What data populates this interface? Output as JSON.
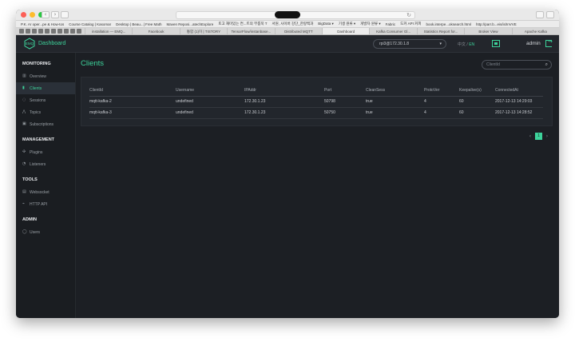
{
  "browser": {
    "bookmarks": [
      "P.K. Ar oper...pe & How-tos",
      "Course Catalog | Kasomar",
      "Desktop | Beau...| Free Math",
      "Maven Reposi...atechExplore",
      "토고 재미있는 컨...트의 부룹북 T",
      "서원, 사이버 강단_한랑백과",
      "BigData ▾",
      "기생 원류 ▾",
      "개발자 원류 ▾",
      "Fabric",
      "도커 API 커피",
      "book.interpe...oksearch.html",
      "http://parr.b...eis/is/InVVE"
    ],
    "tabs": [
      "installation — EMQ...",
      "Facebook",
      "통합 (1)이 | TISTORY",
      "TensorFlow/instanbase...",
      "Distributed MQTT",
      "Dashboard",
      "Kafka Consumer Gl...",
      "Statistics Report for...",
      "Broker View",
      "Apache Kafka"
    ],
    "active_tab_index": 5
  },
  "header": {
    "logo_text": "EMQ",
    "brand": "Dashboard",
    "node": "rpi3@172.30.1.8",
    "lang_ko": "中文",
    "lang_sep": " / ",
    "lang_en": "EN",
    "user": "admin"
  },
  "sidebar": {
    "sections": [
      {
        "title": "MONITORING",
        "items": [
          {
            "label": "Overview",
            "icon": "chart-icon"
          },
          {
            "label": "Clients",
            "icon": "document-icon",
            "active": true
          },
          {
            "label": "Sessions",
            "icon": "sessions-icon"
          },
          {
            "label": "Topics",
            "icon": "topics-icon"
          },
          {
            "label": "Subscriptions",
            "icon": "subscriptions-icon"
          }
        ]
      },
      {
        "title": "MANAGEMENT",
        "items": [
          {
            "label": "Plugins",
            "icon": "plugin-icon"
          },
          {
            "label": "Listeners",
            "icon": "listener-icon"
          }
        ]
      },
      {
        "title": "TOOLS",
        "items": [
          {
            "label": "Websocket",
            "icon": "websocket-icon"
          },
          {
            "label": "HTTP API",
            "icon": "api-icon"
          }
        ]
      },
      {
        "title": "ADMIN",
        "items": [
          {
            "label": "Users",
            "icon": "users-icon"
          }
        ]
      }
    ]
  },
  "main": {
    "title": "Clients",
    "search_placeholder": "ClientId",
    "columns": [
      "ClientId",
      "Username",
      "IPAddr",
      "Port",
      "CleanSess",
      "ProtoVer",
      "Keepalive(s)",
      "ConnectedAt"
    ],
    "rows": [
      [
        "mqtt-kafka-2",
        "undefined",
        "172.30.1.23",
        "50798",
        "true",
        "4",
        "60",
        "2017-12-13 14:29:03"
      ],
      [
        "mqtt-kafka-3",
        "undefined",
        "172.30.1.23",
        "50750",
        "true",
        "4",
        "60",
        "2017-12-13 14:28:52"
      ]
    ],
    "pagination": {
      "prev": "‹",
      "current": "1",
      "next": "›"
    }
  }
}
